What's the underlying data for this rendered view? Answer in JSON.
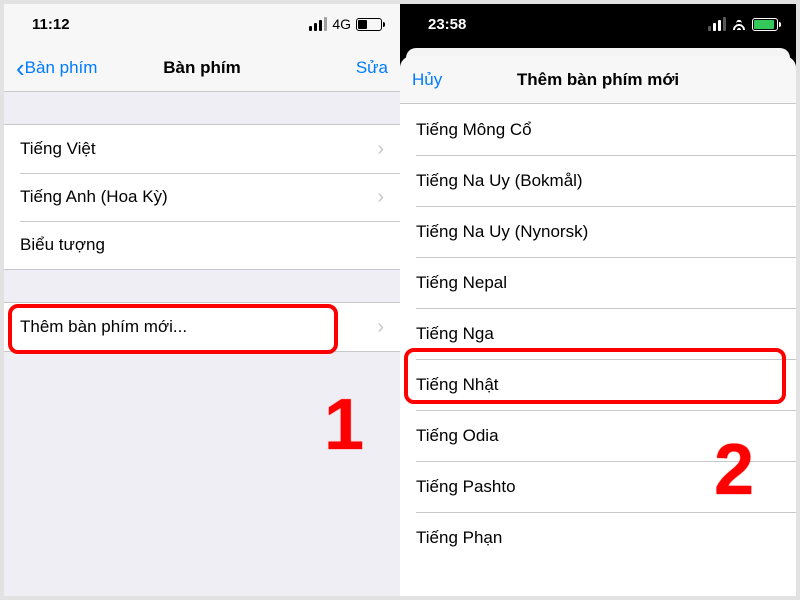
{
  "left": {
    "status": {
      "time": "11:12",
      "network": "4G"
    },
    "nav": {
      "back": "Bàn phím",
      "title": "Bàn phím",
      "edit": "Sửa"
    },
    "keyboards": [
      {
        "label": "Tiếng Việt",
        "chevron": true
      },
      {
        "label": "Tiếng Anh (Hoa Kỳ)",
        "chevron": true
      },
      {
        "label": "Biểu tượng",
        "chevron": false
      }
    ],
    "add_new": "Thêm bàn phím mới...",
    "step": "1"
  },
  "right": {
    "status": {
      "time": "23:58"
    },
    "nav": {
      "cancel": "Hủy",
      "title": "Thêm bàn phím mới"
    },
    "languages": [
      "Tiếng Mông Cổ",
      "Tiếng Na Uy (Bokmål)",
      "Tiếng Na Uy (Nynorsk)",
      "Tiếng Nepal",
      "Tiếng Nga",
      "Tiếng Nhật",
      "Tiếng Odia",
      "Tiếng Pashto",
      "Tiếng Phạn"
    ],
    "step": "2"
  }
}
